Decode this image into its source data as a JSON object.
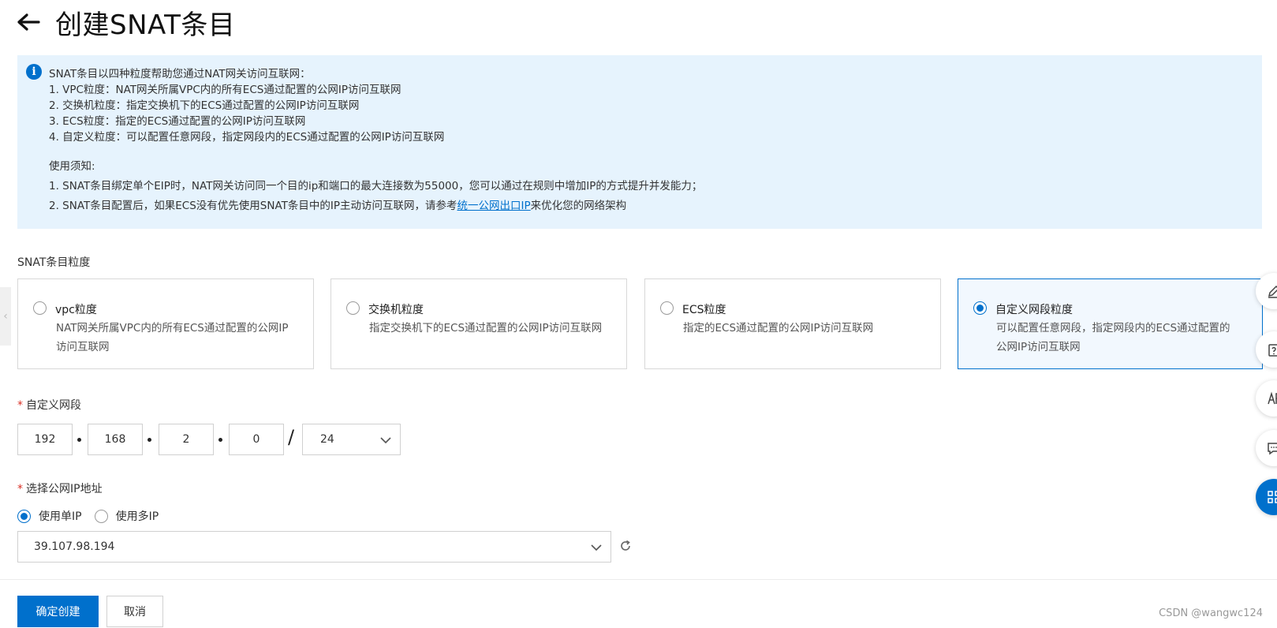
{
  "header": {
    "title": "创建SNAT条目"
  },
  "notice": {
    "intro": "SNAT条目以四种粒度帮助您通过NAT网关访问互联网：",
    "items": [
      "1. VPC粒度：NAT网关所属VPC内的所有ECS通过配置的公网IP访问互联网",
      "2. 交换机粒度：指定交换机下的ECS通过配置的公网IP访问互联网",
      "3. ECS粒度：指定的ECS通过配置的公网IP访问互联网",
      "4. 自定义粒度：可以配置任意网段，指定网段内的ECS通过配置的公网IP访问互联网"
    ],
    "usage_title": "使用须知:",
    "usage_1": "1. SNAT条目绑定单个EIP时，NAT网关访问同一个目的ip和端口的最大连接数为55000，您可以通过在规则中增加IP的方式提升并发能力；",
    "usage_2_prefix": "2. SNAT条目配置后，如果ECS没有优先使用SNAT条目中的IP主动访问互联网，请参考",
    "usage_2_link": "统一公网出口IP",
    "usage_2_suffix": "来优化您的网络架构"
  },
  "granularity": {
    "label": "SNAT条目粒度",
    "options": [
      {
        "title": "vpc粒度",
        "desc": "NAT网关所属VPC内的所有ECS通过配置的公网IP访问互联网"
      },
      {
        "title": "交换机粒度",
        "desc": "指定交换机下的ECS通过配置的公网IP访问互联网"
      },
      {
        "title": "ECS粒度",
        "desc": "指定的ECS通过配置的公网IP访问互联网"
      },
      {
        "title": "自定义网段粒度",
        "desc": "可以配置任意网段，指定网段内的ECS通过配置的公网IP访问互联网"
      }
    ],
    "selected_index": 3
  },
  "cidr": {
    "label": "自定义网段",
    "octets": [
      "192",
      "168",
      "2",
      "0"
    ],
    "separator": "/",
    "mask": "24"
  },
  "public_ip": {
    "label": "选择公网IP地址",
    "modes": [
      "使用单IP",
      "使用多IP"
    ],
    "selected_mode": 0,
    "selected_ip": "39.107.98.194"
  },
  "footer": {
    "confirm_label": "确定创建",
    "cancel_label": "取消",
    "watermark": "CSDN @wangwc124"
  },
  "colors": {
    "primary": "#0070cc",
    "notice_bg": "#e6f3fd",
    "required": "#d93026"
  },
  "icons": [
    "back-arrow-icon",
    "info-icon",
    "chevron-down-icon",
    "refresh-icon",
    "edit-icon",
    "clipboard-question-icon",
    "font-icon",
    "feedback-icon",
    "apps-icon"
  ]
}
